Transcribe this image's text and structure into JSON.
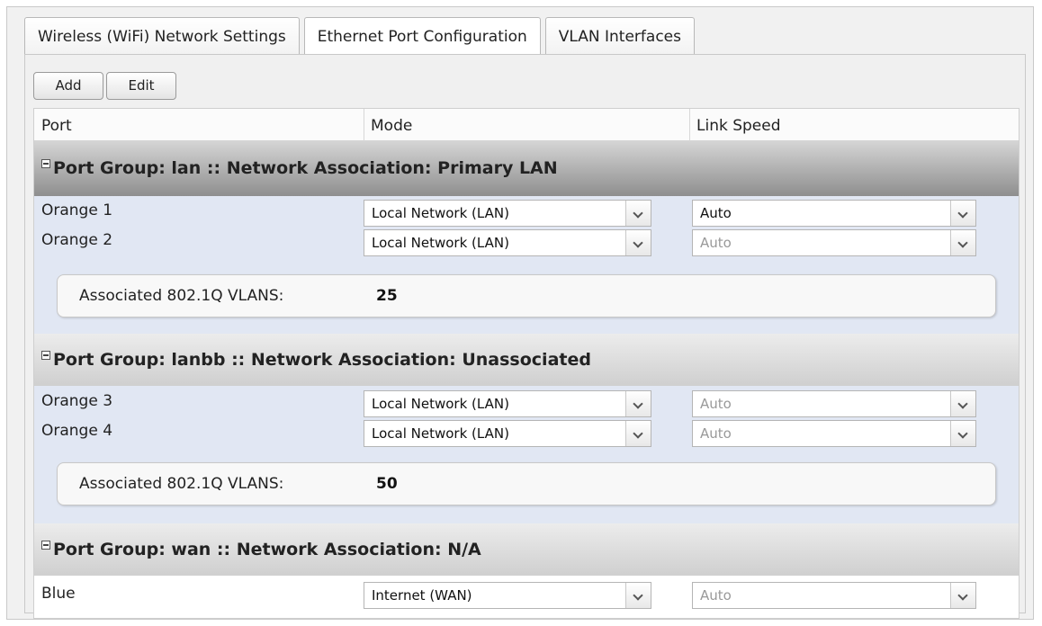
{
  "tabs": [
    {
      "label": "Wireless (WiFi) Network Settings",
      "active": false
    },
    {
      "label": "Ethernet Port Configuration",
      "active": true
    },
    {
      "label": "VLAN Interfaces",
      "active": false
    }
  ],
  "toolbar": {
    "add_label": "Add",
    "edit_label": "Edit"
  },
  "columns": {
    "port": "Port",
    "mode": "Mode",
    "link_speed": "Link Speed"
  },
  "groups": [
    {
      "title": "Port Group: lan :: Network Association: Primary LAN",
      "rows": [
        {
          "port": "Orange 1",
          "mode": "Local Network (LAN)",
          "speed": "Auto",
          "speed_enabled": true
        },
        {
          "port": "Orange 2",
          "mode": "Local Network (LAN)",
          "speed": "Auto",
          "speed_enabled": false
        }
      ],
      "vlan_label": "Associated 802.1Q VLANS:",
      "vlan_value": "25"
    },
    {
      "title": "Port Group: lanbb :: Network Association: Unassociated",
      "rows": [
        {
          "port": "Orange 3",
          "mode": "Local Network (LAN)",
          "speed": "Auto",
          "speed_enabled": false
        },
        {
          "port": "Orange 4",
          "mode": "Local Network (LAN)",
          "speed": "Auto",
          "speed_enabled": false
        }
      ],
      "vlan_label": "Associated 802.1Q VLANS:",
      "vlan_value": "50"
    },
    {
      "title": "Port Group: wan :: Network Association: N/A",
      "rows": [
        {
          "port": "Blue",
          "mode": "Internet (WAN)",
          "speed": "Auto",
          "speed_enabled": false
        }
      ]
    }
  ],
  "colors": {
    "group_body": "#e1e7f3",
    "disabled_text": "#999999"
  },
  "icons": {
    "expander": "collapse-icon",
    "dropdown": "chevron-down-icon"
  }
}
